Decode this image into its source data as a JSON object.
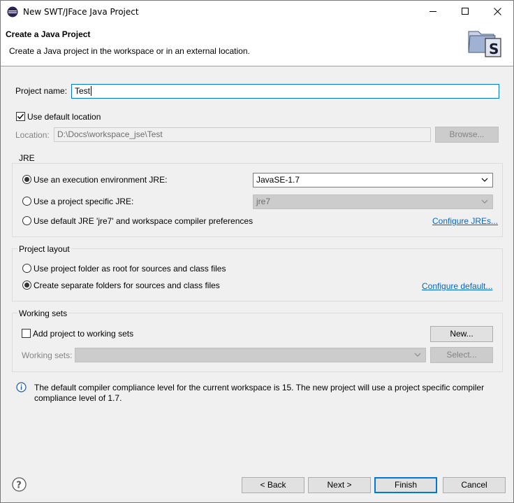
{
  "window": {
    "title": "New SWT/JFace Java Project"
  },
  "banner": {
    "title": "Create a Java Project",
    "description": "Create a Java project in the workspace or in an external location."
  },
  "project": {
    "name_label": "Project name:",
    "name_value": "Test",
    "use_default_location_label": "Use default location",
    "use_default_location_checked": true,
    "location_label": "Location:",
    "location_value": "D:\\Docs\\workspace_jse\\Test",
    "browse_label": "Browse..."
  },
  "jre": {
    "group_label": "JRE",
    "opt_execution_env_label": "Use an execution environment JRE:",
    "execution_env_value": "JavaSE-1.7",
    "opt_project_specific_label": "Use a project specific JRE:",
    "project_specific_value": "jre7",
    "opt_default_label": "Use default JRE 'jre7' and workspace compiler preferences",
    "configure_jres_link": "Configure JREs...",
    "selected": "execution_env"
  },
  "layout": {
    "group_label": "Project layout",
    "opt_root_label": "Use project folder as root for sources and class files",
    "opt_separate_label": "Create separate folders for sources and class files",
    "configure_default_link": "Configure default...",
    "selected": "separate"
  },
  "working_sets": {
    "group_label": "Working sets",
    "add_label": "Add project to working sets",
    "add_checked": false,
    "new_button": "New...",
    "sets_label": "Working sets:",
    "sets_value": "",
    "select_button": "Select..."
  },
  "info": {
    "message": "The default compiler compliance level for the current workspace is 15. The new project will use a project specific compiler compliance level of 1.7."
  },
  "footer": {
    "back_label": "< Back",
    "next_label": "Next >",
    "finish_label": "Finish",
    "cancel_label": "Cancel"
  },
  "colors": {
    "accent": "#0078d7",
    "link": "#0066cc"
  }
}
